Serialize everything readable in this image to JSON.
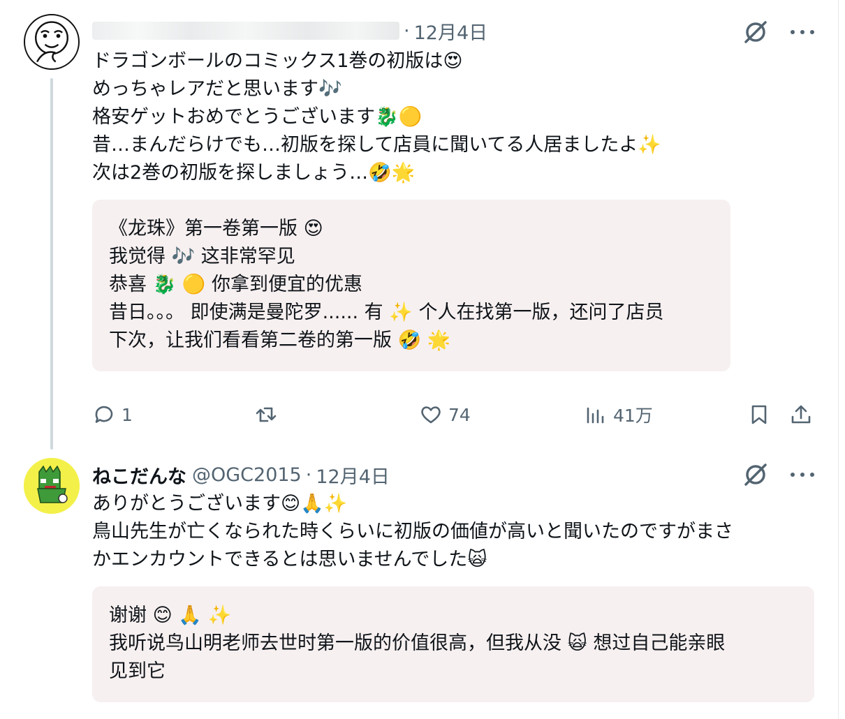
{
  "tweets": [
    {
      "display_name": "",
      "handle": "",
      "date": "12月4日",
      "avatar_icon": "cartoon-face-avatar",
      "lines": [
        [
          "ドラゴンボールのコミックス1巻の初版は",
          "😍"
        ],
        [
          "めっちゃレアだと思います",
          "🎶"
        ],
        [
          "格安ゲットおめでとうございます",
          "🐉🟡"
        ],
        [
          "昔…まんだらけでも…初版を探して店員に聞いてる人居ましたよ",
          "✨"
        ],
        [
          "次は2巻の初版を探しましょう…",
          "🤣🌟"
        ]
      ],
      "translation_lines": [
        [
          "《龙珠》第一卷第一版 ",
          "😍",
          ""
        ],
        [
          "我觉得 ",
          "🎶",
          " 这非常罕见"
        ],
        [
          "恭喜 ",
          "🐉 🟡",
          " 你拿到便宜的优惠"
        ],
        [
          "昔日。。。 即使满是曼陀罗...... 有 ",
          "✨",
          " 个人在找第一版，还问了店员"
        ],
        [
          "下次，让我们看看第二卷的第一版       ",
          "🤣  🌟",
          ""
        ]
      ],
      "actions": {
        "reply_count": "1",
        "retweet_count": "",
        "like_count": "74",
        "view_count": "41万"
      }
    },
    {
      "display_name": "ねこだんな",
      "handle": "@OGC2015",
      "date": "12月4日",
      "avatar_icon": "green-dragon-avatar",
      "lines": [
        [
          "ありがとうございます",
          "😊🙏✨"
        ],
        [
          "鳥山先生が亡くなられた時くらいに初版の価値が高いと聞いたのですがまさ",
          ""
        ],
        [
          "かエンカウントできるとは思いませんでした",
          "🙀"
        ]
      ],
      "translation_lines": [
        [
          "谢谢 ",
          "😊 🙏 ✨",
          ""
        ],
        [
          "我听说鸟山明老师去世时第一版的价值很高，但我从没 ",
          "🙀",
          " 想过自己能亲眼"
        ],
        [
          "见到它",
          "",
          ""
        ]
      ]
    }
  ],
  "separator": "·",
  "colors": {
    "muted": "#536471",
    "translation_bg": "#f7f0f0",
    "thread_line": "#cfd9de"
  }
}
